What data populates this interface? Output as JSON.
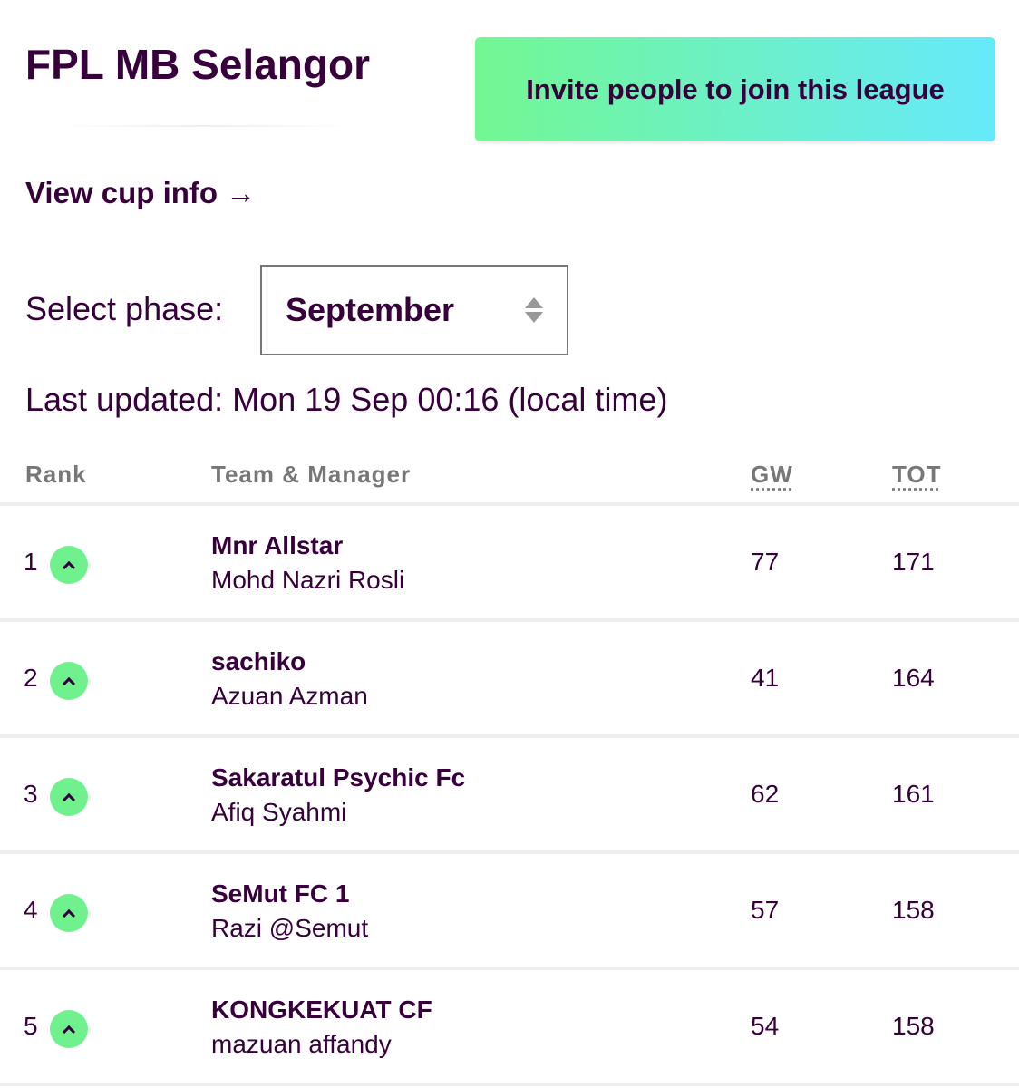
{
  "league": {
    "title": "FPL MB Selangor",
    "invite_label": "Invite people to join this league",
    "cup_link": "View cup info →"
  },
  "phase": {
    "label": "Select phase:",
    "selected": "September"
  },
  "last_updated": "Last updated: Mon 19 Sep 00:16 (local time)",
  "table": {
    "headers": {
      "rank": "Rank",
      "team": "Team & Manager",
      "gw": "GW",
      "tot": "TOT"
    },
    "rows": [
      {
        "rank": "1",
        "movement": "up",
        "team": "Mnr Allstar",
        "manager": "Mohd Nazri Rosli",
        "gw": "77",
        "tot": "171"
      },
      {
        "rank": "2",
        "movement": "up",
        "team": "sachiko",
        "manager": "Azuan Azman",
        "gw": "41",
        "tot": "164"
      },
      {
        "rank": "3",
        "movement": "up",
        "team": "Sakaratul Psychic Fc",
        "manager": "Afiq Syahmi",
        "gw": "62",
        "tot": "161"
      },
      {
        "rank": "4",
        "movement": "up",
        "team": "SeMut FC 1",
        "manager": "Razi @Semut",
        "gw": "57",
        "tot": "158"
      },
      {
        "rank": "5",
        "movement": "up",
        "team": "KONGKEKUAT CF",
        "manager": "mazuan affandy",
        "gw": "54",
        "tot": "158"
      }
    ]
  },
  "colors": {
    "text": "#37003c",
    "movement_up": "#6ff28e",
    "invite_gradient": [
      "#72f792",
      "#66e9fb"
    ]
  }
}
